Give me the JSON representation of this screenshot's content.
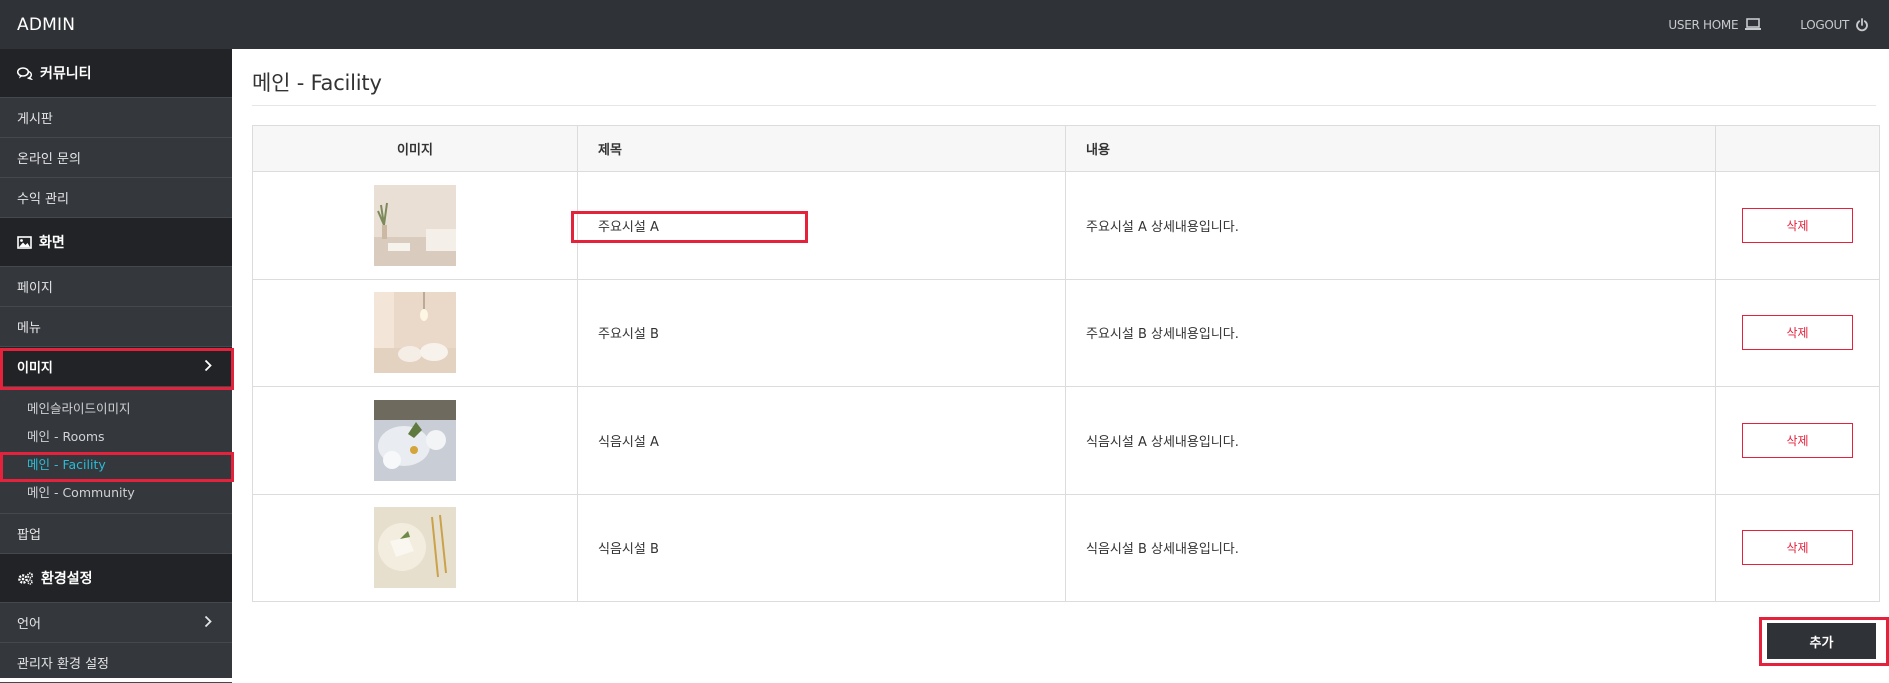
{
  "topbar": {
    "brand": "ADMIN",
    "user_home": "USER HOME",
    "logout": "LOGOUT"
  },
  "sidebar": {
    "community": {
      "header": "커뮤니티",
      "items": [
        "게시판",
        "온라인 문의",
        "수익 관리"
      ]
    },
    "screen": {
      "header": "화면",
      "items": [
        "페이지",
        "메뉴"
      ],
      "image_label": "이미지",
      "image_sub": [
        "메인슬라이드이미지",
        "메인 - Rooms",
        "메인 - Facility",
        "메인 - Community"
      ],
      "popup": "팝업"
    },
    "settings": {
      "header": "환경설정",
      "items": [
        "언어",
        "관리자 환경 설정"
      ]
    }
  },
  "main": {
    "title": "메인 - Facility",
    "columns": [
      "이미지",
      "제목",
      "내용",
      ""
    ],
    "rows": [
      {
        "title": "주요시설 A",
        "desc": "주요시설 A 상세내용입니다.",
        "action": "삭제"
      },
      {
        "title": "주요시설 B",
        "desc": "주요시설 B 상세내용입니다.",
        "action": "삭제"
      },
      {
        "title": "식음시설 A",
        "desc": "식음시설 A 상세내용입니다.",
        "action": "삭제"
      },
      {
        "title": "식음시설 B",
        "desc": "식음시설 B 상세내용입니다.",
        "action": "삭제"
      }
    ],
    "add_label": "추가"
  },
  "colors": {
    "topbar": "#2f3237",
    "sidebar": "#34373c",
    "sidebar_header": "#212326",
    "accent_link": "#2bbcd6",
    "danger": "#e4223c"
  }
}
